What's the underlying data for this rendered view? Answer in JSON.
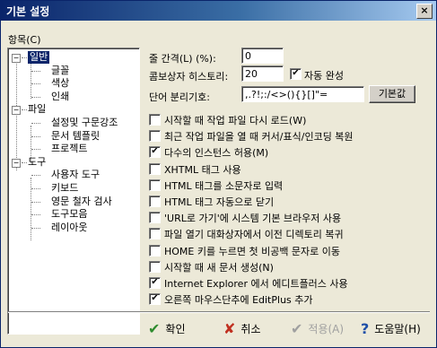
{
  "window": {
    "title": "기본 설정",
    "close": "×"
  },
  "tree": {
    "label": "항목(C)",
    "nodes": [
      {
        "label": "일반",
        "level": 0,
        "expand": "−",
        "selected": true
      },
      {
        "label": "글꼴",
        "level": 1
      },
      {
        "label": "색상",
        "level": 1
      },
      {
        "label": "인쇄",
        "level": 1
      },
      {
        "label": "파일",
        "level": 0,
        "expand": "−"
      },
      {
        "label": "설정및 구문강조",
        "level": 1
      },
      {
        "label": "문서 템플릿",
        "level": 1
      },
      {
        "label": "프로젝트",
        "level": 1
      },
      {
        "label": "도구",
        "level": 0,
        "expand": "−"
      },
      {
        "label": "사용자 도구",
        "level": 1
      },
      {
        "label": "키보드",
        "level": 1
      },
      {
        "label": "영문 철자 검사",
        "level": 1
      },
      {
        "label": "도구모음",
        "level": 1
      },
      {
        "label": "레이아웃",
        "level": 1
      }
    ]
  },
  "settings": {
    "line_spacing_label": "줄 간격(L) (%):",
    "line_spacing_value": "0",
    "combo_history_label": "콤보상자 히스토리:",
    "combo_history_value": "20",
    "auto_complete_label": "자동 완성",
    "auto_complete_checked": true,
    "word_delim_label": "단어 분리기호:",
    "word_delim_value": ",.?!;:/<>(){}[]\"=",
    "default_button": "기본값"
  },
  "options": [
    {
      "label": "시작할 때 작업 파일 다시 로드(W)",
      "checked": false
    },
    {
      "label": "최근 작업 파일을 열 때 커서/표식/인코딩 복원",
      "checked": false
    },
    {
      "label": "다수의 인스턴스 허용(M)",
      "checked": true
    },
    {
      "label": "XHTML 태그 사용",
      "checked": false
    },
    {
      "label": "HTML 태그를 소문자로 입력",
      "checked": false
    },
    {
      "label": "HTML 태그 자동으로 닫기",
      "checked": false
    },
    {
      "label": "'URL로 가기'에 시스템 기본 브라우저 사용",
      "checked": false
    },
    {
      "label": "파일 열기 대화상자에서 이전 디렉토리 복귀",
      "checked": false
    },
    {
      "label": "HOME 키를 누르면 첫 비공백 문자로 이동",
      "checked": false
    },
    {
      "label": "시작할 때 새 문서 생성(N)",
      "checked": false
    },
    {
      "label": "Internet Explorer 에서 에디트플러스 사용",
      "checked": true
    },
    {
      "label": "오른쪽 마우스단추에 EditPlus 추가",
      "checked": true
    }
  ],
  "buttons": {
    "ok": {
      "label": "확인",
      "icon": "✔",
      "color": "#2e8b2e"
    },
    "cancel": {
      "label": "취소",
      "icon": "✘",
      "color": "#c03020"
    },
    "apply": {
      "label": "적용(A)",
      "icon": "✔",
      "disabled": true
    },
    "help": {
      "label": "도움말(H)",
      "icon": "?",
      "color": "#1f4fa8"
    }
  },
  "colors": {
    "title_bar": "#0a246a",
    "selection": "#0a246a",
    "dialog_bg": "#ece9d8"
  }
}
